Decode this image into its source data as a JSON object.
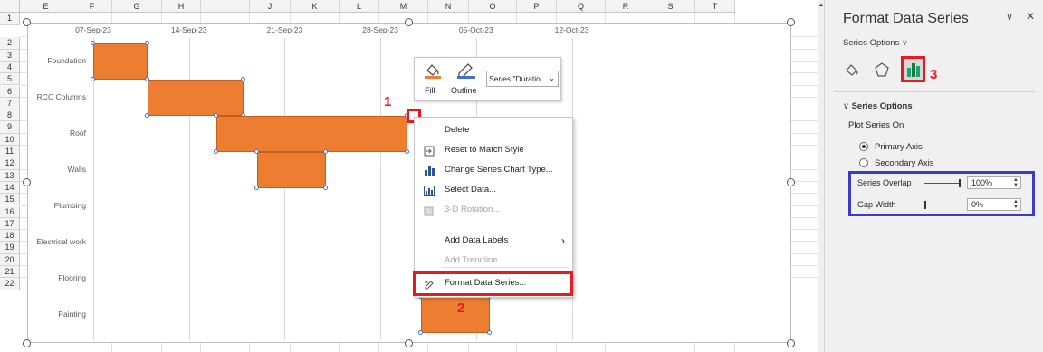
{
  "sheet": {
    "columns": [
      "E",
      "F",
      "G",
      "H",
      "I",
      "J",
      "K",
      "L",
      "M",
      "N",
      "O",
      "P",
      "Q",
      "R",
      "S",
      "T"
    ],
    "rows": [
      "1",
      "2",
      "3",
      "4",
      "5",
      "6",
      "7",
      "8",
      "9",
      "10",
      "11",
      "12",
      "13",
      "14",
      "15",
      "16",
      "17",
      "18",
      "19",
      "20",
      "21",
      "22"
    ]
  },
  "chart_data": {
    "type": "bar",
    "x_ticks": [
      "07-Sep-23",
      "14-Sep-23",
      "21-Sep-23",
      "28-Sep-23",
      "05-Oct-23",
      "12-Oct-23"
    ],
    "categories": [
      "Foundation",
      "RCC Columns",
      "Roof",
      "Walls",
      "Plumbing",
      "Electrical work",
      "Flooring",
      "Painting"
    ],
    "series": [
      {
        "name": "Duration",
        "start": [
          "2023-09-07",
          "2023-09-11",
          "2023-09-16",
          "2023-09-19",
          null,
          null,
          null,
          "2023-10-01"
        ],
        "days": [
          4,
          7,
          14,
          5,
          null,
          null,
          null,
          5
        ]
      }
    ],
    "colors": {
      "bar": "#ed7d31"
    }
  },
  "mini_toolbar": {
    "fill_label": "Fill",
    "outline_label": "Outline",
    "series_select": "Series \"Duratio"
  },
  "context_menu": {
    "items": [
      {
        "label": "Delete",
        "icon": "none",
        "enabled": true
      },
      {
        "label": "Reset to Match Style",
        "icon": "reset-style-icon",
        "enabled": true
      },
      {
        "label": "Change Series Chart Type...",
        "icon": "chart-type-icon",
        "enabled": true
      },
      {
        "label": "Select Data...",
        "icon": "select-data-icon",
        "enabled": true
      },
      {
        "label": "3-D Rotation...",
        "icon": "rotation-icon",
        "enabled": false
      },
      {
        "label": "Add Data Labels",
        "icon": "none",
        "enabled": true
      },
      {
        "label": "Add Trendline...",
        "icon": "none",
        "enabled": false
      },
      {
        "label": "Format Data Series...",
        "icon": "format-icon",
        "enabled": true
      }
    ]
  },
  "annotations": {
    "n1": "1",
    "n2": "2",
    "n3": "3"
  },
  "panel": {
    "title": "Format Data Series",
    "series_options_dropdown": "Series Options",
    "section_title": "Series Options",
    "plot_series_on": "Plot Series On",
    "primary_axis": "Primary Axis",
    "secondary_axis": "Secondary Axis",
    "series_overlap_label": "Series Overlap",
    "series_overlap_value": "100%",
    "gap_width_label": "Gap Width",
    "gap_width_value": "0%"
  }
}
